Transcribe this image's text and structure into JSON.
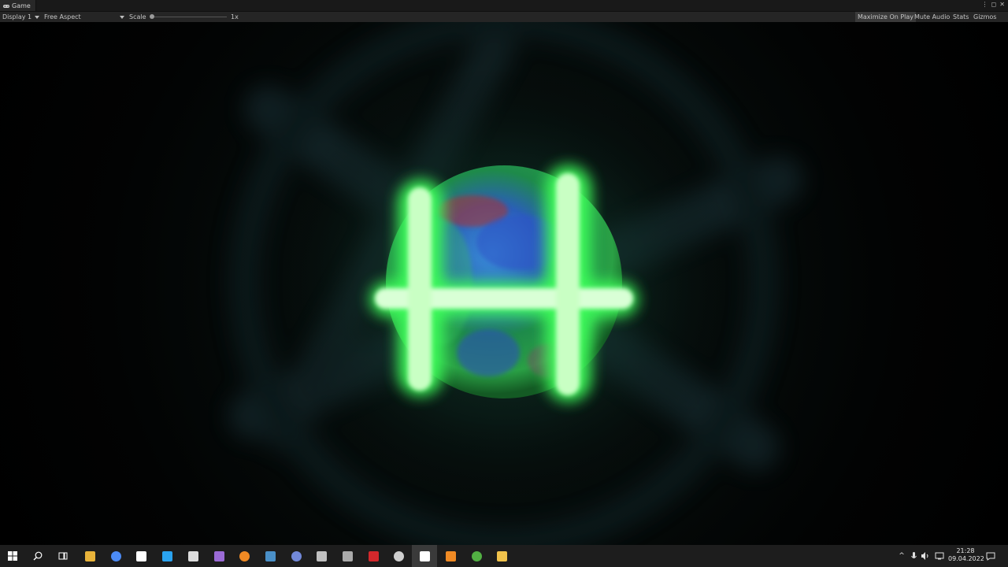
{
  "window": {
    "tab_title": "Game"
  },
  "toolbar": {
    "display": "Display 1",
    "aspect": "Free Aspect",
    "scale_label": "Scale",
    "scale_value": "1x",
    "maximize_on_play": "Maximize On Play",
    "mute_audio": "Mute Audio",
    "stats": "Stats",
    "gizmos": "Gizmos"
  },
  "taskbar": {
    "apps": [
      {
        "name": "file-explorer-icon",
        "color": "#e8b33a"
      },
      {
        "name": "chrome-icon",
        "color": "#4c8bf5"
      },
      {
        "name": "app-icon",
        "color": "#ffffff"
      },
      {
        "name": "vscode-icon",
        "color": "#2aa3f0"
      },
      {
        "name": "unity-hub-icon",
        "color": "#dddddd"
      },
      {
        "name": "github-icon",
        "color": "#9b6bd6"
      },
      {
        "name": "blender-icon",
        "color": "#f08a24"
      },
      {
        "name": "steam-icon",
        "color": "#4a90c8"
      },
      {
        "name": "discord-icon",
        "color": "#7289da"
      },
      {
        "name": "app2-icon",
        "color": "#c0c0c0"
      },
      {
        "name": "unity-icon",
        "color": "#aaaaaa"
      },
      {
        "name": "filezilla-icon",
        "color": "#d4282c"
      },
      {
        "name": "clock-app-icon",
        "color": "#cfcfcf"
      },
      {
        "name": "unity-editor-icon",
        "color": "#ffffff"
      },
      {
        "name": "blender-2-icon",
        "color": "#f08a24"
      },
      {
        "name": "xbox-icon",
        "color": "#52b043"
      },
      {
        "name": "notes-icon",
        "color": "#f0c24b"
      }
    ],
    "time": "21:28",
    "date": "09.04.2022"
  }
}
